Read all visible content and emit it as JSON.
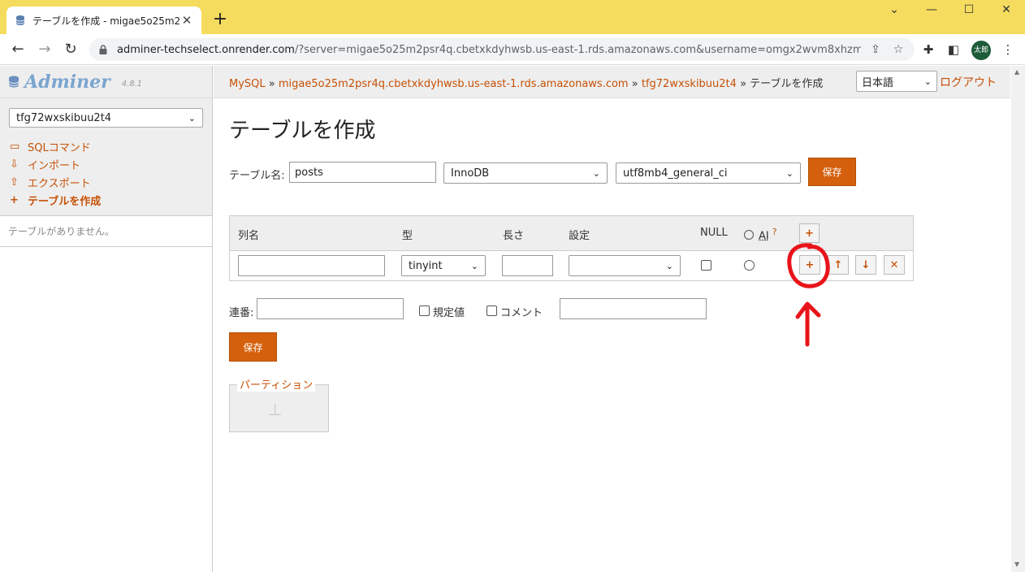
{
  "browser": {
    "tab_title": "テーブルを作成 - migae5o25m2psr",
    "url_host": "adminer-techselect.onrender.com",
    "url_rest": "/?server=migae5o25m2psr4q.cbetxkdyhwsb.us-east-1.rds.amazonaws.com&username=omgx2wvm8xhzmxi6&d...",
    "avatar_text": "太郎",
    "accent_color": "#f5dc5e"
  },
  "sidebar": {
    "logo": "Adminer",
    "version": "4.8.1",
    "database": "tfg72wxskibuu2t4",
    "menu": [
      {
        "icon": "sql-icon",
        "label": "SQLコマンド"
      },
      {
        "icon": "import-icon",
        "label": "インポート"
      },
      {
        "icon": "export-icon",
        "label": "エクスポート"
      },
      {
        "icon": "plus-icon",
        "label": "テーブルを作成"
      }
    ],
    "no_tables": "テーブルがありません。"
  },
  "header": {
    "breadcrumb": {
      "mysql": "MySQL",
      "sep": "»",
      "server": "migae5o25m2psr4q.cbetxkdyhwsb.us-east-1.rds.amazonaws.com",
      "db": "tfg72wxskibuu2t4",
      "current": "テーブルを作成"
    },
    "language": "日本語",
    "logout": "ログアウト"
  },
  "form": {
    "page_title": "テーブルを作成",
    "table_name_label": "テーブル名:",
    "table_name_value": "posts",
    "engine": "InnoDB",
    "collation": "utf8mb4_general_ci",
    "save_label": "保存",
    "columns_header": {
      "name": "列名",
      "type": "型",
      "length": "長さ",
      "options": "設定",
      "null": "NULL",
      "ai": "AI",
      "help": "?"
    },
    "row": {
      "name_value": "",
      "type_value": "tinyint",
      "length_value": "",
      "options_value": ""
    },
    "auto_increment_label": "連番:",
    "default_label": "規定値",
    "comment_label": "コメント",
    "partition_legend": "パーティション"
  },
  "colors": {
    "link": "#c65106",
    "button": "#d4600d",
    "annotation": "#e8141a"
  }
}
